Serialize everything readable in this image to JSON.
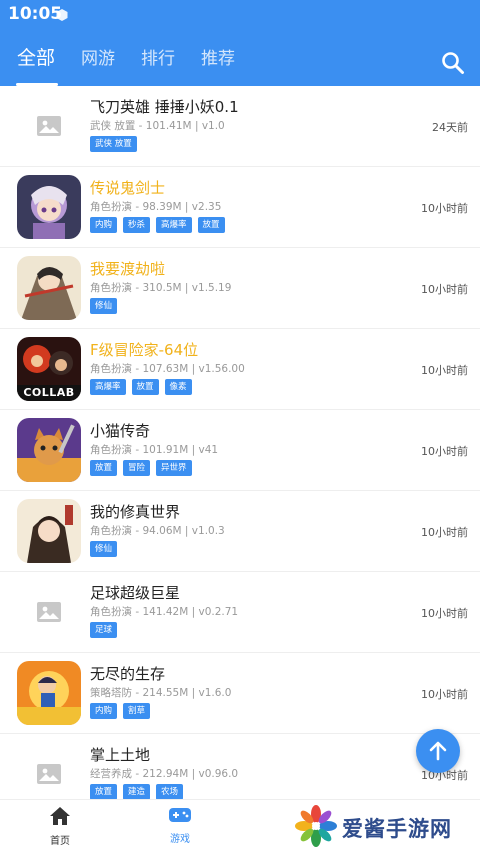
{
  "status": {
    "time": "10:05"
  },
  "tabs": [
    {
      "label": "全部",
      "active": true
    },
    {
      "label": "网游",
      "active": false
    },
    {
      "label": "排行",
      "active": false
    },
    {
      "label": "推荐",
      "active": false
    }
  ],
  "colors": {
    "accent": "#3b8ff1",
    "title_highlight": "#f1b21b"
  },
  "games": [
    {
      "title": "飞刀英雄 捶捶小妖0.1",
      "meta": "武侠 放置 - 101.41M | v1.0",
      "tags": [
        "武侠 放置"
      ],
      "time": "24天前",
      "icon": "image-placeholder-icon"
    },
    {
      "title": "传说鬼剑士",
      "meta": "角色扮演 - 98.39M | v2.35",
      "tags": [
        "内购",
        "秒杀",
        "高爆率",
        "放置"
      ],
      "time": "10小时前",
      "icon": "game-icon"
    },
    {
      "title": "我要渡劫啦",
      "meta": "角色扮演 - 310.5M | v1.5.19",
      "tags": [
        "修仙"
      ],
      "time": "10小时前",
      "icon": "game-icon"
    },
    {
      "title": "F级冒险家-64位",
      "meta": "角色扮演 - 107.63M | v1.56.00",
      "tags": [
        "高爆率",
        "放置",
        "像素"
      ],
      "time": "10小时前",
      "icon": "game-icon",
      "icon_text": "COLLAB"
    },
    {
      "title": "小猫传奇",
      "meta": "角色扮演 - 101.91M | v41",
      "tags": [
        "放置",
        "冒险",
        "异世界"
      ],
      "time": "10小时前",
      "icon": "game-icon"
    },
    {
      "title": "我的修真世界",
      "meta": "角色扮演 - 94.06M | v1.0.3",
      "tags": [
        "修仙"
      ],
      "time": "10小时前",
      "icon": "game-icon"
    },
    {
      "title": "足球超级巨星",
      "meta": "角色扮演 - 141.42M | v0.2.71",
      "tags": [
        "足球"
      ],
      "time": "10小时前",
      "icon": "image-placeholder-icon"
    },
    {
      "title": "无尽的生存",
      "meta": "策略塔防 - 214.55M | v1.6.0",
      "tags": [
        "内购",
        "割草"
      ],
      "time": "10小时前",
      "icon": "game-icon"
    },
    {
      "title": "掌上土地",
      "meta": "经营养成 - 212.94M | v0.96.0",
      "tags": [
        "放置",
        "建造",
        "农场"
      ],
      "time": "10小时前",
      "icon": "image-placeholder-icon"
    }
  ],
  "bottom_nav": [
    {
      "label": "首页",
      "icon": "home-icon",
      "active": false
    },
    {
      "label": "游戏",
      "icon": "gamepad-icon",
      "active": true
    }
  ],
  "watermark": {
    "text": "爱酱手游网"
  }
}
